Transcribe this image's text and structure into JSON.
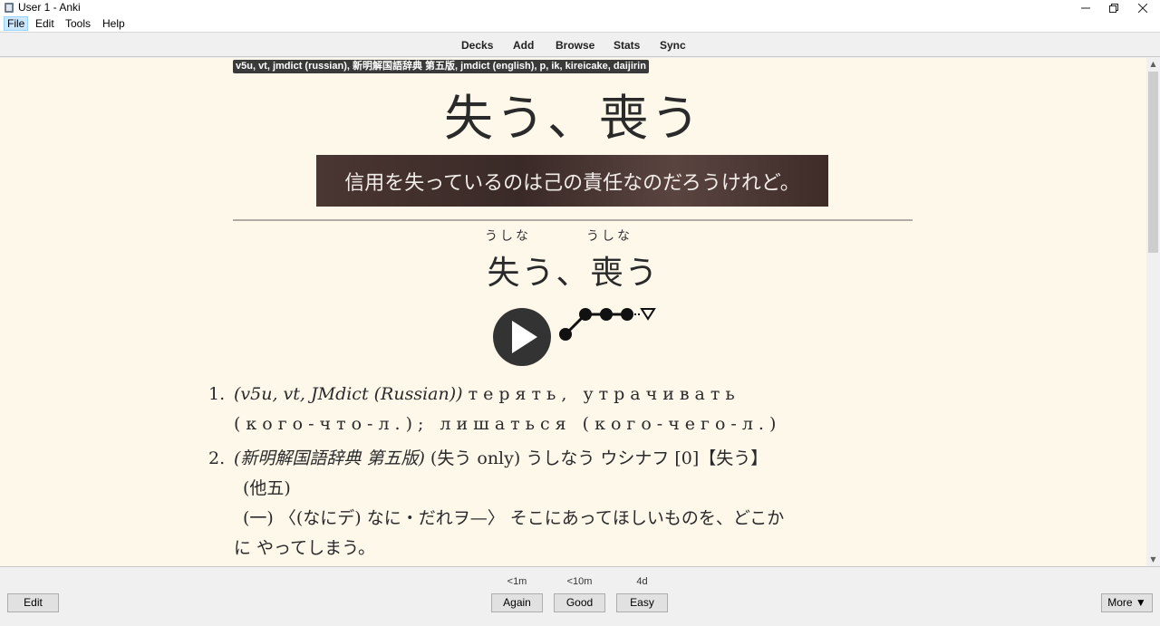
{
  "window": {
    "title": "User 1 - Anki",
    "minimize": "—",
    "maximize": "❐",
    "close": "✕"
  },
  "menu": {
    "file": "File",
    "edit": "Edit",
    "tools": "Tools",
    "help": "Help"
  },
  "toolbar": {
    "decks": "Decks",
    "add": "Add",
    "browse": "Browse",
    "stats": "Stats",
    "sync": "Sync"
  },
  "card": {
    "tags": "v5u, vt, jmdict (russian), 新明解国語辞典 第五版, jmdict (english), p, ik, kireicake, daijirin",
    "front_word": "失う、喪う",
    "sentence": "信用を失っているのは己の責任なのだろうけれど。",
    "reading_1": "うしな",
    "reading_2": "うしな",
    "back_word": "失う、喪う",
    "definitions": {
      "n1": "1.",
      "d1_source": "(v5u, vt, JMdict (Russian))",
      "d1_text": "терять, утрачивать",
      "d1_line2": "(кого-что-л.); лишаться (кого-чего-л.)",
      "n2": "2.",
      "d2_source": "(新明解国語辞典 第五版)",
      "d2_text": "(失う only) うしなう ウシナフ [0]【失う】",
      "d2_line2": "(他五)",
      "d2_line3": "(一) 〈(なにデ) なに・だれヲ—〉 そこにあってほしいものを、どこか",
      "d2_line4": "に やってしまう。"
    }
  },
  "answer": {
    "edit": "Edit",
    "again": "Again",
    "again_ivl": "<1m",
    "good": "Good",
    "good_ivl": "<10m",
    "easy": "Easy",
    "easy_ivl": "4d",
    "more": "More ▼"
  },
  "icons": {
    "app": "anki-icon",
    "play": "play-icon",
    "pitch": "pitch-accent-graph-icon"
  }
}
